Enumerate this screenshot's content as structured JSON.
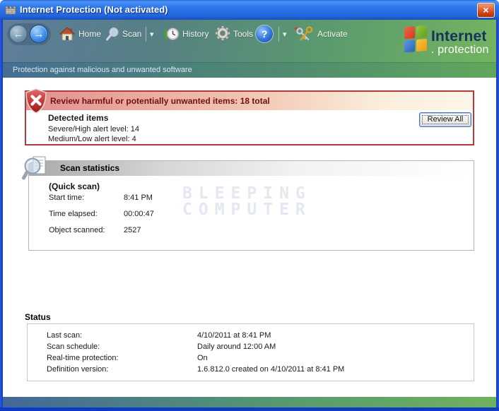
{
  "titlebar": {
    "title": "Internet Protection (Not activated)",
    "close_glyph": "×"
  },
  "toolbar": {
    "back_glyph": "←",
    "forward_glyph": "→",
    "home_label": "Home",
    "scan_label": "Scan",
    "history_label": "History",
    "tools_label": "Tools",
    "help_glyph": "?",
    "caret_glyph": "▾",
    "activate_label": "Activate"
  },
  "logo": {
    "brand_top": "Internet",
    "brand_bottom": ". protection"
  },
  "subtitle": "Protection against malicious and unwanted software",
  "alert": {
    "banner": "Review harmful or potentially unwanted items: 18 total",
    "detected_title": "Detected items",
    "line1": "Severe/High alert level: 14",
    "line2": "Medium/Low alert level: 4",
    "review_all_label": "Review All"
  },
  "scan_stats": {
    "header": "Scan statistics",
    "scan_type": "(Quick scan)",
    "rows": [
      {
        "label": "Start time:",
        "value": "8:41 PM"
      },
      {
        "label": "Time elapsed:",
        "value": "00:00:47"
      },
      {
        "label": "Object scanned:",
        "value": "2527"
      }
    ]
  },
  "watermark": {
    "line1": "BLEEPING",
    "line2": "COMPUTER"
  },
  "status": {
    "header": "Status",
    "rows": [
      {
        "label": "Last scan:",
        "value": "4/10/2011 at 8:41 PM"
      },
      {
        "label": "Scan schedule:",
        "value": "Daily around 12:00 AM"
      },
      {
        "label": "Real-time protection:",
        "value": "On"
      },
      {
        "label": "Definition version:",
        "value": "1.6.812.0 created on 4/10/2011 at 8:41 PM"
      }
    ]
  },
  "colors": {
    "titlebar_blue": "#2f78ec",
    "window_border": "#1139c8",
    "band_left": "#5f7e9c",
    "band_right": "#74b55f",
    "alert_border": "#b23a3a",
    "alert_text": "#701010",
    "watermark": "#e3e8f2"
  }
}
